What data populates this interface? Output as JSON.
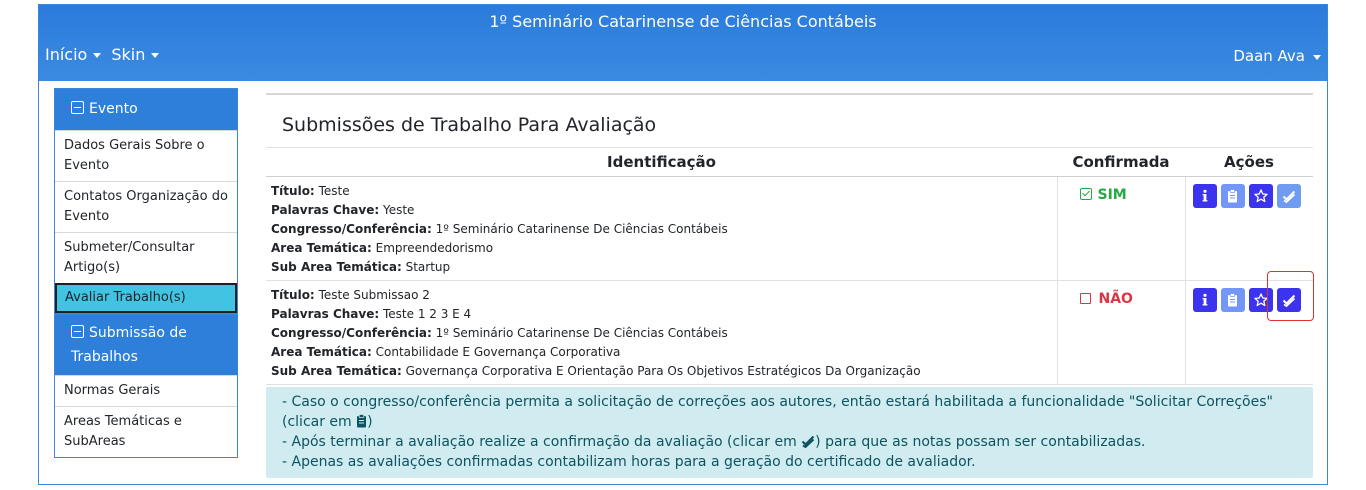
{
  "header": {
    "title": "1º Seminário Catarinense de Ciências Contábeis",
    "nav": [
      {
        "label": "Início",
        "icon": "caret-down-icon"
      },
      {
        "label": "Skin",
        "icon": "caret-down-icon"
      }
    ],
    "user": "Daan Ava"
  },
  "sidebar": {
    "groups": [
      {
        "title": "Evento",
        "items": [
          {
            "label": "Dados Gerais Sobre o Evento",
            "active": false
          },
          {
            "label": "Contatos Organização do Evento",
            "active": false
          },
          {
            "label": "Submeter/Consultar Artigo(s)",
            "active": false
          },
          {
            "label": "Avaliar Trabalho(s)",
            "active": true
          }
        ]
      },
      {
        "title": "Submissão de Trabalhos",
        "items": [
          {
            "label": "Normas Gerais",
            "active": false
          },
          {
            "label": "Areas Temáticas e SubAreas",
            "active": false
          }
        ]
      }
    ]
  },
  "main": {
    "title": "Submissões de Trabalho Para Avaliação",
    "columns": [
      "Identificação",
      "Confirmada",
      "Ações"
    ],
    "field_labels": {
      "titulo": "Título:",
      "palavras": "Palavras Chave:",
      "congresso": "Congresso/Conferência:",
      "area": "Area Temática:",
      "subarea": "Sub Area Temática:"
    },
    "rows": [
      {
        "titulo": "Teste",
        "palavras": "Yeste",
        "congresso": "1º Seminário Catarinense De Ciências Contábeis",
        "area": "Empreendedorismo",
        "subarea": "Startup",
        "confirmada": "SIM"
      },
      {
        "titulo": "Teste Submissao 2",
        "palavras": "Teste 1 2 3 E 4",
        "congresso": "1º Seminário Catarinense De Ciências Contábeis",
        "area": "Contabilidade E Governança Corporativa",
        "subarea": "Governança Corporativa E Orientação Para Os Objetivos Estratégicos Da Organização",
        "confirmada": "NÃO"
      }
    ],
    "actions": [
      "info-icon",
      "clipboard-icon",
      "star-icon",
      "double-check-icon"
    ],
    "notes": {
      "line1_pre": "- Caso o congresso/conferência permita a solicitação de correções aos autores, então estará habilitada a funcionalidade \"Solicitar Correções\" (clicar em ",
      "line1_post": ")",
      "line2_pre": "- Após terminar a avaliação realize a confirmação da avaliação (clicar em ",
      "line2_post": ") para que as notas possam ser contabilizadas.",
      "line3": "- Apenas as avaliações confirmadas contabilizam horas para a geração do certificado de avaliador."
    }
  },
  "colors": {
    "header": "#2a7bdc",
    "active_item": "#40c4e2",
    "confirm_yes": "#28a745",
    "confirm_no": "#dc3545",
    "action_dark": "#3c33ee",
    "action_light": "#7397f6",
    "alert_bg": "#d1ecf1"
  }
}
